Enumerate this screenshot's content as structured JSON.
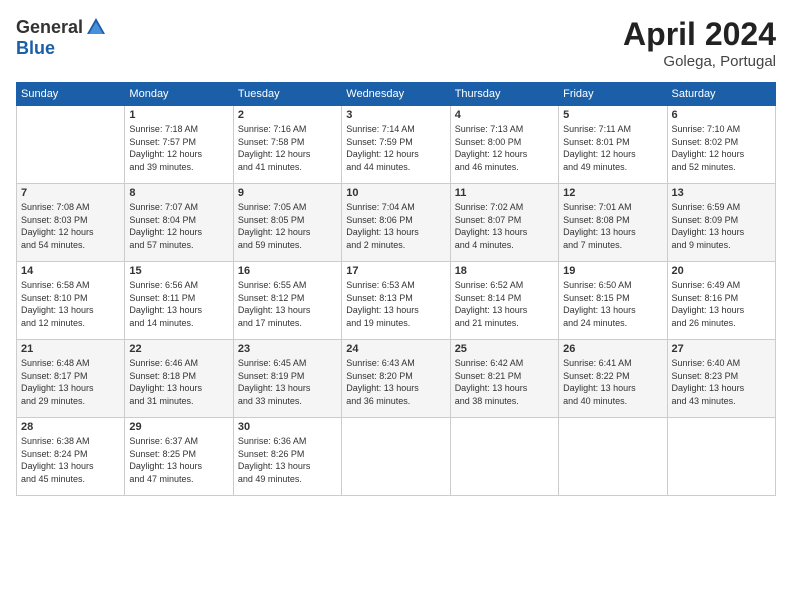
{
  "header": {
    "logo_general": "General",
    "logo_blue": "Blue",
    "month": "April 2024",
    "location": "Golega, Portugal"
  },
  "weekdays": [
    "Sunday",
    "Monday",
    "Tuesday",
    "Wednesday",
    "Thursday",
    "Friday",
    "Saturday"
  ],
  "weeks": [
    [
      {
        "day": "",
        "info": ""
      },
      {
        "day": "1",
        "info": "Sunrise: 7:18 AM\nSunset: 7:57 PM\nDaylight: 12 hours\nand 39 minutes."
      },
      {
        "day": "2",
        "info": "Sunrise: 7:16 AM\nSunset: 7:58 PM\nDaylight: 12 hours\nand 41 minutes."
      },
      {
        "day": "3",
        "info": "Sunrise: 7:14 AM\nSunset: 7:59 PM\nDaylight: 12 hours\nand 44 minutes."
      },
      {
        "day": "4",
        "info": "Sunrise: 7:13 AM\nSunset: 8:00 PM\nDaylight: 12 hours\nand 46 minutes."
      },
      {
        "day": "5",
        "info": "Sunrise: 7:11 AM\nSunset: 8:01 PM\nDaylight: 12 hours\nand 49 minutes."
      },
      {
        "day": "6",
        "info": "Sunrise: 7:10 AM\nSunset: 8:02 PM\nDaylight: 12 hours\nand 52 minutes."
      }
    ],
    [
      {
        "day": "7",
        "info": "Sunrise: 7:08 AM\nSunset: 8:03 PM\nDaylight: 12 hours\nand 54 minutes."
      },
      {
        "day": "8",
        "info": "Sunrise: 7:07 AM\nSunset: 8:04 PM\nDaylight: 12 hours\nand 57 minutes."
      },
      {
        "day": "9",
        "info": "Sunrise: 7:05 AM\nSunset: 8:05 PM\nDaylight: 12 hours\nand 59 minutes."
      },
      {
        "day": "10",
        "info": "Sunrise: 7:04 AM\nSunset: 8:06 PM\nDaylight: 13 hours\nand 2 minutes."
      },
      {
        "day": "11",
        "info": "Sunrise: 7:02 AM\nSunset: 8:07 PM\nDaylight: 13 hours\nand 4 minutes."
      },
      {
        "day": "12",
        "info": "Sunrise: 7:01 AM\nSunset: 8:08 PM\nDaylight: 13 hours\nand 7 minutes."
      },
      {
        "day": "13",
        "info": "Sunrise: 6:59 AM\nSunset: 8:09 PM\nDaylight: 13 hours\nand 9 minutes."
      }
    ],
    [
      {
        "day": "14",
        "info": "Sunrise: 6:58 AM\nSunset: 8:10 PM\nDaylight: 13 hours\nand 12 minutes."
      },
      {
        "day": "15",
        "info": "Sunrise: 6:56 AM\nSunset: 8:11 PM\nDaylight: 13 hours\nand 14 minutes."
      },
      {
        "day": "16",
        "info": "Sunrise: 6:55 AM\nSunset: 8:12 PM\nDaylight: 13 hours\nand 17 minutes."
      },
      {
        "day": "17",
        "info": "Sunrise: 6:53 AM\nSunset: 8:13 PM\nDaylight: 13 hours\nand 19 minutes."
      },
      {
        "day": "18",
        "info": "Sunrise: 6:52 AM\nSunset: 8:14 PM\nDaylight: 13 hours\nand 21 minutes."
      },
      {
        "day": "19",
        "info": "Sunrise: 6:50 AM\nSunset: 8:15 PM\nDaylight: 13 hours\nand 24 minutes."
      },
      {
        "day": "20",
        "info": "Sunrise: 6:49 AM\nSunset: 8:16 PM\nDaylight: 13 hours\nand 26 minutes."
      }
    ],
    [
      {
        "day": "21",
        "info": "Sunrise: 6:48 AM\nSunset: 8:17 PM\nDaylight: 13 hours\nand 29 minutes."
      },
      {
        "day": "22",
        "info": "Sunrise: 6:46 AM\nSunset: 8:18 PM\nDaylight: 13 hours\nand 31 minutes."
      },
      {
        "day": "23",
        "info": "Sunrise: 6:45 AM\nSunset: 8:19 PM\nDaylight: 13 hours\nand 33 minutes."
      },
      {
        "day": "24",
        "info": "Sunrise: 6:43 AM\nSunset: 8:20 PM\nDaylight: 13 hours\nand 36 minutes."
      },
      {
        "day": "25",
        "info": "Sunrise: 6:42 AM\nSunset: 8:21 PM\nDaylight: 13 hours\nand 38 minutes."
      },
      {
        "day": "26",
        "info": "Sunrise: 6:41 AM\nSunset: 8:22 PM\nDaylight: 13 hours\nand 40 minutes."
      },
      {
        "day": "27",
        "info": "Sunrise: 6:40 AM\nSunset: 8:23 PM\nDaylight: 13 hours\nand 43 minutes."
      }
    ],
    [
      {
        "day": "28",
        "info": "Sunrise: 6:38 AM\nSunset: 8:24 PM\nDaylight: 13 hours\nand 45 minutes."
      },
      {
        "day": "29",
        "info": "Sunrise: 6:37 AM\nSunset: 8:25 PM\nDaylight: 13 hours\nand 47 minutes."
      },
      {
        "day": "30",
        "info": "Sunrise: 6:36 AM\nSunset: 8:26 PM\nDaylight: 13 hours\nand 49 minutes."
      },
      {
        "day": "",
        "info": ""
      },
      {
        "day": "",
        "info": ""
      },
      {
        "day": "",
        "info": ""
      },
      {
        "day": "",
        "info": ""
      }
    ]
  ]
}
